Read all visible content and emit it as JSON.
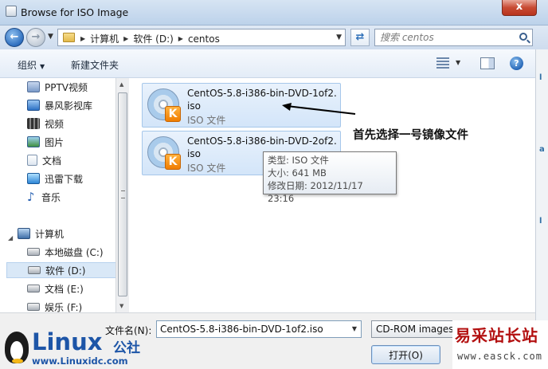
{
  "window": {
    "title": "Browse for ISO Image",
    "close_glyph": "x"
  },
  "address": {
    "crumbs": [
      "计算机",
      "软件 (D:)",
      "centos"
    ],
    "search_placeholder": "搜索 centos"
  },
  "toolbar": {
    "organize": "组织",
    "new_folder": "新建文件夹",
    "help": "?"
  },
  "nav": {
    "items": [
      {
        "label": "PPTV视频",
        "icon": "pptv-icon"
      },
      {
        "label": "暴风影视库",
        "icon": "storm-icon"
      },
      {
        "label": "视频",
        "icon": "video-icon"
      },
      {
        "label": "图片",
        "icon": "picture-icon"
      },
      {
        "label": "文档",
        "icon": "document-icon"
      },
      {
        "label": "迅雷下载",
        "icon": "thunder-icon"
      },
      {
        "label": "音乐",
        "icon": "music-icon"
      }
    ],
    "computer": "计算机",
    "drives": [
      {
        "label": "本地磁盘 (C:)",
        "selected": false
      },
      {
        "label": "软件 (D:)",
        "selected": true
      },
      {
        "label": "文档 (E:)",
        "selected": false
      },
      {
        "label": "娱乐 (F:)",
        "selected": false
      }
    ]
  },
  "files": [
    {
      "name": "CentOS-5.8-i386-bin-DVD-1of2.iso",
      "type": "ISO 文件",
      "icon_badge": "K"
    },
    {
      "name": "CentOS-5.8-i386-bin-DVD-2of2.iso",
      "type": "ISO 文件",
      "icon_badge": "K"
    }
  ],
  "tooltip": {
    "type_line": "类型: ISO 文件",
    "size_line": "大小: 641 MB",
    "date_line": "修改日期: 2012/11/17 23:16"
  },
  "annotation": {
    "text": "首先选择一号镜像文件"
  },
  "bottom": {
    "filename_label": "文件名(N):",
    "filename_value": "CentOS-5.8-i386-bin-DVD-1of2.iso",
    "filter_value": "CD-ROM images",
    "open_label": "打开(O)"
  },
  "watermarks": {
    "linux_brand": "Linux",
    "linux_brand_cn": "公社",
    "linux_url": "www.Linuxidc.com",
    "site_cn": "易采站长站",
    "site_url": "www.easck.com"
  }
}
